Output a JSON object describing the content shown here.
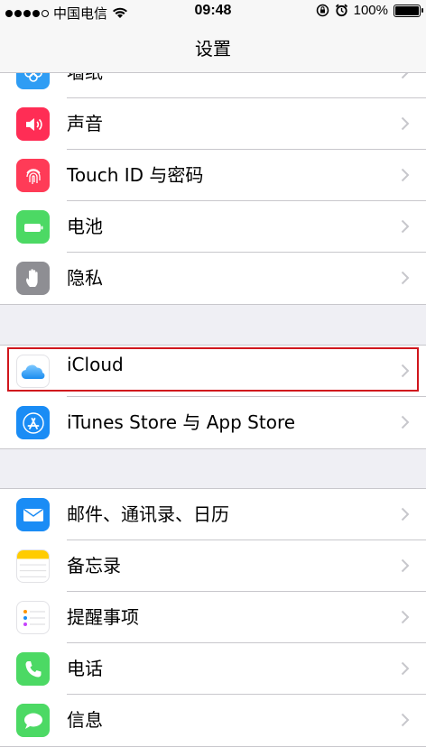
{
  "status_bar": {
    "carrier": "中国电信",
    "time": "09:48",
    "battery": "100%"
  },
  "nav": {
    "title": "设置"
  },
  "group1": {
    "items": [
      {
        "label": "墙纸",
        "icon": "wallpaper-icon",
        "color": "#2f9df4"
      },
      {
        "label": "声音",
        "icon": "speaker-icon",
        "color": "#ff2d55"
      },
      {
        "label": "Touch ID 与密码",
        "icon": "fingerprint-icon",
        "color": "#ff3b57"
      },
      {
        "label": "电池",
        "icon": "battery-icon",
        "color": "#4cd964"
      },
      {
        "label": "隐私",
        "icon": "hand-icon",
        "color": "#8e8e93"
      }
    ]
  },
  "group2": {
    "items": [
      {
        "label": "iCloud",
        "icon": "icloud-icon",
        "color": "#ffffff"
      },
      {
        "label": "iTunes Store 与 App Store",
        "icon": "app-store-icon",
        "color": "#1a8cf5"
      }
    ]
  },
  "group3": {
    "items": [
      {
        "label": "邮件、通讯录、日历",
        "icon": "mail-icon",
        "color": "#1a8cf5"
      },
      {
        "label": "备忘录",
        "icon": "notes-icon",
        "color": "#ffcc00"
      },
      {
        "label": "提醒事项",
        "icon": "reminders-icon",
        "color": "#ffffff"
      },
      {
        "label": "电话",
        "icon": "phone-icon",
        "color": "#4cd964"
      },
      {
        "label": "信息",
        "icon": "messages-icon",
        "color": "#4cd964"
      }
    ]
  },
  "highlight_color": "#d0161d"
}
